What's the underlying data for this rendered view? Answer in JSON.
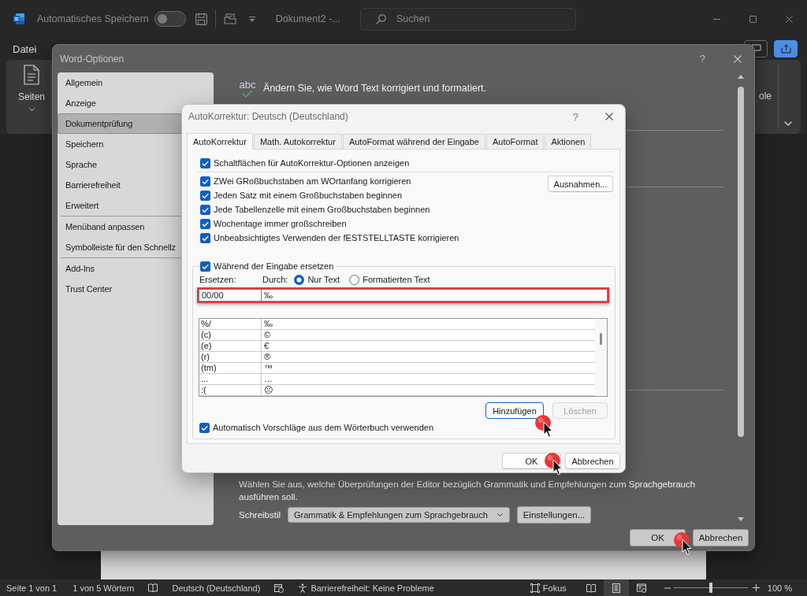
{
  "word_window": {
    "autosave": {
      "label": "Automatisches Speichern",
      "on": false
    },
    "document_title": "Dokument2 -...",
    "search": {
      "placeholder": "Suchen"
    },
    "ribbon": {
      "file_tab": "Datei",
      "pages_button": "Seiten",
      "cut_label": "ole"
    },
    "status_bar": {
      "page": "Seite 1 von 1",
      "words": "1 von 5 Wörtern",
      "language": "Deutsch (Deutschland)",
      "accessibility": "Barrierefreiheit: Keine Probleme",
      "focus": "Fokus",
      "views": [
        {
          "kind": "read",
          "selected": false
        },
        {
          "kind": "print",
          "selected": true
        },
        {
          "kind": "web",
          "selected": false
        }
      ],
      "zoom": {
        "level": 0.5,
        "reading": "100 %"
      }
    }
  },
  "options_dialog": {
    "title": "Word-Optionen",
    "help_button": "?",
    "sidebar": {
      "groups": [
        {
          "items": [
            {
              "label": "Allgemein",
              "selected": false
            },
            {
              "label": "Anzeige",
              "selected": false
            },
            {
              "label": "Dokumentprüfung",
              "selected": true
            },
            {
              "label": "Speichern",
              "selected": false
            },
            {
              "label": "Sprache",
              "selected": false
            },
            {
              "label": "Barrierefreiheit",
              "selected": false
            },
            {
              "label": "Erweitert",
              "selected": false
            }
          ]
        },
        {
          "items": [
            {
              "label": "Menüband anpassen",
              "selected": false
            },
            {
              "label": "Symbolleiste für den Schnellz",
              "selected": false
            }
          ]
        },
        {
          "items": [
            {
              "label": "Add-Ins",
              "selected": false
            },
            {
              "label": "Trust Center",
              "selected": false
            }
          ]
        }
      ]
    },
    "header": {
      "icon_text": "abc",
      "title": "Ändern Sie, wie Word Text korrigiert und formatiert."
    },
    "writing_style": {
      "description": "Wählen Sie aus, welche Überprüfungen der Editor bezüglich Grammatik und Empfehlungen zum Sprachgebrauch ausführen soll.",
      "label": "Schreibstil",
      "value": "Grammatik & Empfehlungen zum Sprachgebrauch",
      "settings_button": "Einstellungen..."
    },
    "buttons": [
      {
        "label": "OK",
        "click_marker": true
      },
      {
        "label": "Abbrechen",
        "click_marker": false
      }
    ]
  },
  "autocorrect_dialog": {
    "title": "AutoKorrektur: Deutsch (Deutschland)",
    "help_button": "?",
    "tabs": [
      {
        "label": "AutoKorrektur",
        "selected": true
      },
      {
        "label": "Math. Autokorrektur",
        "selected": false
      },
      {
        "label": "AutoFormat während der Eingabe",
        "selected": false
      },
      {
        "label": "AutoFormat",
        "selected": false
      },
      {
        "label": "Aktionen",
        "selected": false
      }
    ],
    "show_option_buttons": {
      "label": "Schaltflächen für AutoKorrektur-Optionen anzeigen",
      "checked": true
    },
    "options": [
      {
        "label": "ZWei GRoßbuchstaben am WOrtanfang korrigieren",
        "checked": true
      },
      {
        "label": "Jeden Satz mit einem Großbuchstaben beginnen",
        "checked": true
      },
      {
        "label": "Jede Tabellenzelle mit einem Großbuchstaben beginnen",
        "checked": true
      },
      {
        "label": "Wochentage immer großschreiben",
        "checked": true
      },
      {
        "label": "Unbeabsichtigtes Verwenden der fESTSTELLTASTE korrigieren",
        "checked": true
      }
    ],
    "exceptions_button": "Ausnahmen...",
    "replace_group": {
      "toggle": {
        "label": "Während der Eingabe ersetzen",
        "checked": true
      },
      "replace_label": "Ersetzen:",
      "with_label": "Durch:",
      "format_options": [
        {
          "label": "Nur Text",
          "selected": true
        },
        {
          "label": "Formatierten Text",
          "selected": false
        }
      ],
      "replace_row": {
        "replace": "00/00",
        "with": "‰",
        "highlighted": true
      },
      "entries": [
        {
          "replace": "%/",
          "with": "‰"
        },
        {
          "replace": "(c)",
          "with": "©"
        },
        {
          "replace": "(e)",
          "with": "€"
        },
        {
          "replace": "(r)",
          "with": "®"
        },
        {
          "replace": "(tm)",
          "with": "™"
        },
        {
          "replace": "...",
          "with": "…"
        },
        {
          "replace": ":(",
          "with": "☹"
        }
      ],
      "buttons": [
        {
          "label": "Hinzufügen",
          "focused": true,
          "disabled": false,
          "click_marker": true
        },
        {
          "label": "Löschen",
          "focused": false,
          "disabled": true,
          "click_marker": false
        }
      ],
      "suggestions": {
        "label": "Automatisch Vorschläge aus dem Wörterbuch verwenden",
        "checked": true
      }
    },
    "buttons": [
      {
        "label": "OK",
        "click_marker": true
      },
      {
        "label": "Abbrechen",
        "click_marker": false
      }
    ]
  }
}
